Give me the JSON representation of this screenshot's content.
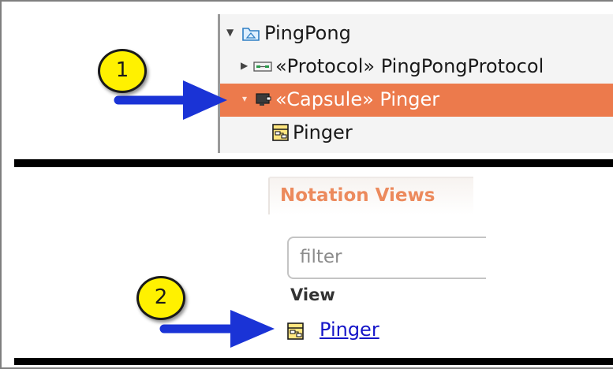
{
  "tree": {
    "items": [
      {
        "label": "PingPong",
        "icon": "package-icon"
      },
      {
        "label": "«Protocol» PingPongProtocol",
        "icon": "protocol-icon"
      },
      {
        "label": "«Capsule» Pinger",
        "icon": "capsule-icon",
        "selected": true
      },
      {
        "label": "Pinger",
        "icon": "state-machine-icon"
      }
    ]
  },
  "notation_views": {
    "tab_label": "Notation Views",
    "filter_placeholder": "filter",
    "column_header": "View",
    "link_label": "Pinger",
    "link_icon": "state-machine-icon"
  },
  "callouts": [
    {
      "number": "1"
    },
    {
      "number": "2"
    }
  ],
  "colors": {
    "selection": "#ec7a4c",
    "tab_text": "#ec8a5d",
    "link": "#1515c8",
    "callout_fill": "#fff100",
    "arrow": "#1a33d6"
  }
}
